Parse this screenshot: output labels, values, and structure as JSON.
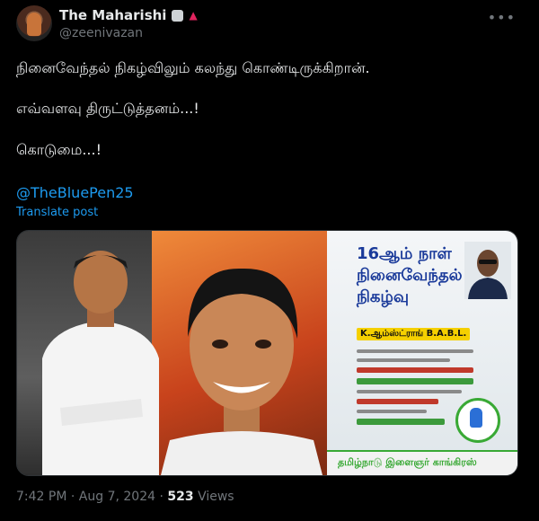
{
  "author": {
    "display_name": "The Maharishi",
    "handle": "@zeenivazan",
    "flag_glyph": "▲",
    "icons": [
      "verified-badge-icon",
      "flag-icon",
      "more-icon"
    ]
  },
  "tweet": {
    "lines": [
      "நினைவேந்தல் நிகழ்விலும் கலந்து கொண்டிருக்கிறான்.",
      "எவ்வளவு திருட்டுத்தனம்...!",
      "கொடுமை...!"
    ],
    "mention": "@TheBluePen25",
    "translate_label": "Translate post"
  },
  "poster": {
    "headline_lines": [
      "16ஆம் நாள்",
      "நினைவேந்தல்",
      "நிகழ்வு"
    ],
    "name_strip": "K.ஆம்ஸ்ட்ராங் B.A.B.L.",
    "footer": "தமிழ்நாடு இளைஞர் காங்கிரஸ்"
  },
  "meta": {
    "time": "7:42 PM",
    "separator": "·",
    "date": "Aug 7, 2024",
    "views_count": "523",
    "views_label": "Views"
  },
  "colors": {
    "link": "#1d9bf0",
    "muted": "#71767b",
    "text": "#e7e9ea",
    "background": "#000000"
  }
}
